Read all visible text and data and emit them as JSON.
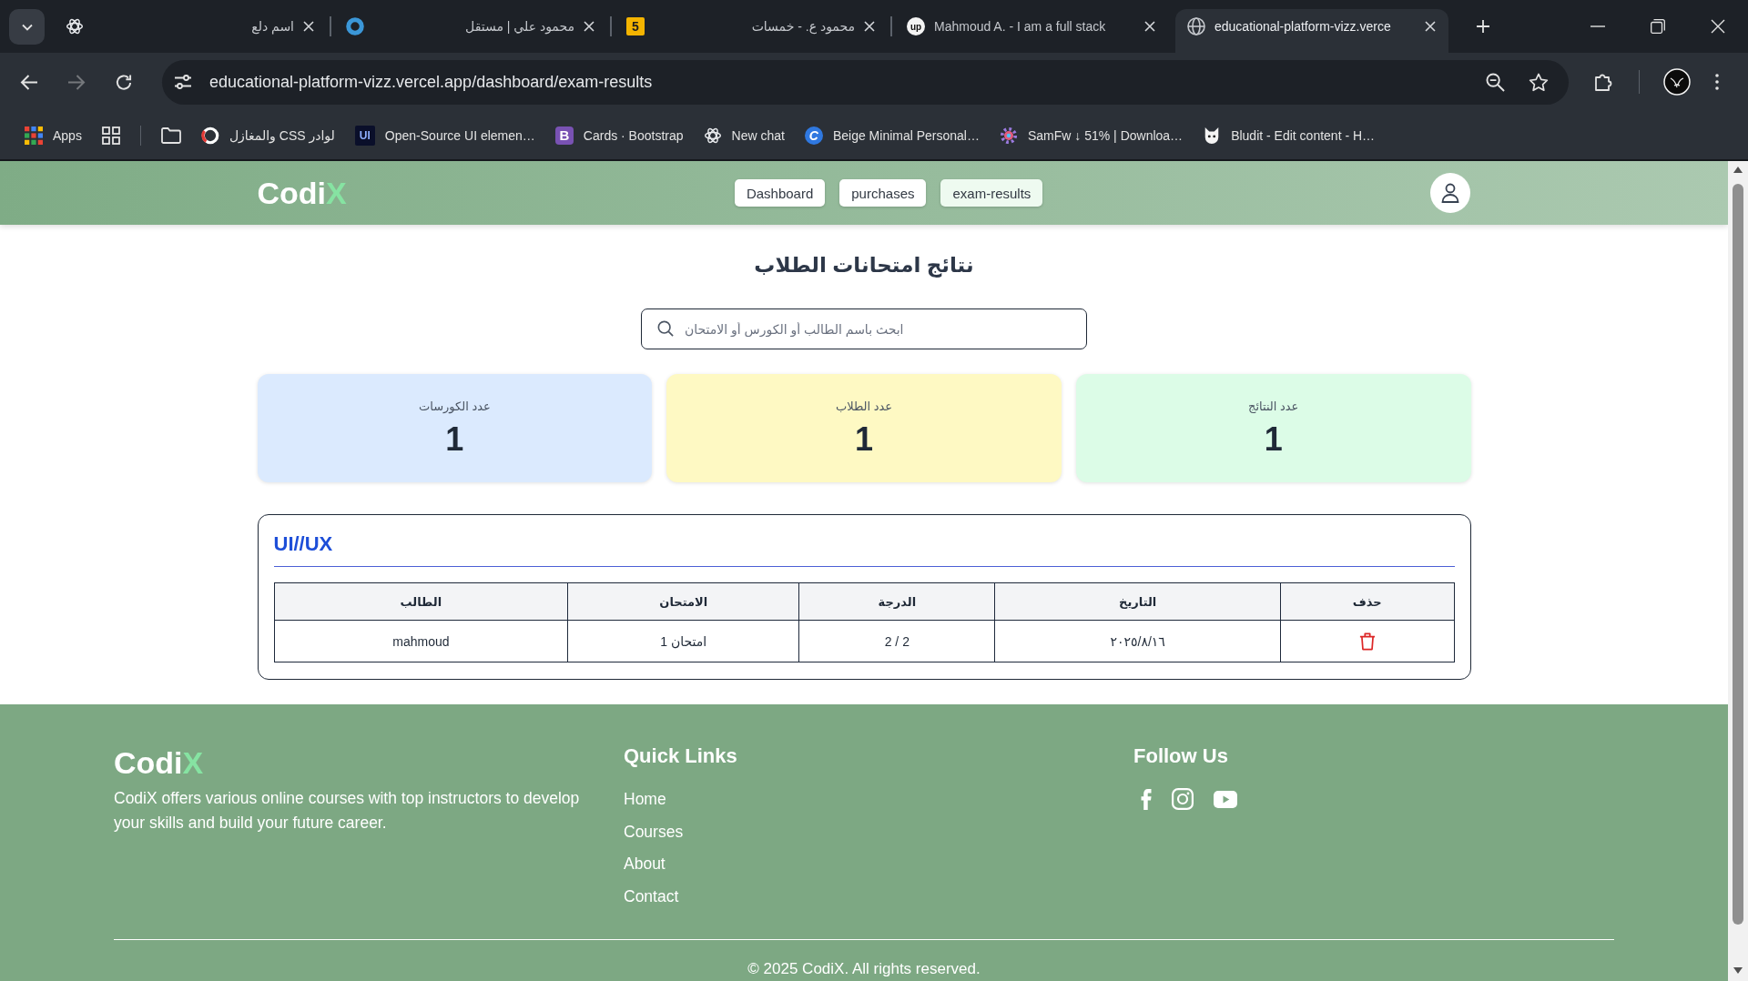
{
  "browser": {
    "tabs": [
      {
        "title": "educational-platform-vizz.verce",
        "kind": "globe",
        "selected": true
      },
      {
        "title": "Mahmoud A. - I am a full stack",
        "kind": "badge",
        "icon_text": "up",
        "selected": false
      },
      {
        "title": "محمود ع. - خمسات",
        "kind": "tile",
        "icon_text": "5",
        "selected": false
      },
      {
        "title": "محمود علي | مستقل",
        "kind": "ring",
        "selected": false
      },
      {
        "title": "اسم دلع",
        "kind": "atom",
        "selected": false
      }
    ],
    "forward_disabled": true,
    "url": "educational-platform-vizz.vercel.app/dashboard/exam-results",
    "bookmarks": [
      {
        "label": "Bludit - Edit content - H…",
        "kind": "cat"
      },
      {
        "label": "SamFw ↓ 51% | Downloa…",
        "kind": "flower"
      },
      {
        "label": "Beige Minimal Personal…",
        "kind": "circle",
        "icon_text": "C"
      },
      {
        "label": "New chat",
        "kind": "atom"
      },
      {
        "label": "Cards · Bootstrap",
        "kind": "purple-tile",
        "icon_text": "B"
      },
      {
        "label": "Open-Source UI elemen…",
        "kind": "dark-tile",
        "icon_text": "UI"
      },
      {
        "label": "لوادر CSS والمغازل",
        "kind": "loader"
      }
    ],
    "apps_label": "Apps"
  },
  "site": {
    "logo": {
      "text": "Codi",
      "accent": "X"
    },
    "nav": [
      {
        "label": "exam-results",
        "selected": true
      },
      {
        "label": "purchases",
        "selected": false
      },
      {
        "label": "Dashboard",
        "selected": false
      }
    ]
  },
  "page_title": "نتائج امتحانات الطلاب",
  "search": {
    "placeholder": "ابحث باسم الطالب أو الكورس أو الامتحان"
  },
  "stats": [
    {
      "label": "عدد النتائج",
      "value": "1",
      "color": "#dcfce7"
    },
    {
      "label": "عدد الطلاب",
      "value": "1",
      "color": "#fef9c3"
    },
    {
      "label": "عدد الكورسات",
      "value": "1",
      "color": "#dbeafe"
    }
  ],
  "courses": [
    {
      "title": "UI//UX",
      "columns": [
        "حذف",
        "التاريخ",
        "الدرجة",
        "الامتحان",
        "الطالب"
      ],
      "rows": [
        {
          "cells": [
            "",
            "٢٠٢٥/٨/١٦",
            "2 / 2",
            "امتحان 1",
            "mahmoud"
          ]
        }
      ]
    }
  ],
  "footer": {
    "logo": {
      "text": "Codi",
      "accent": "X"
    },
    "description": "CodiX offers various online courses with top instructors to develop your skills and build your future career.",
    "links_title": "Quick Links",
    "links": [
      "Home",
      "Courses",
      "About",
      "Contact"
    ],
    "social_title": "Follow Us",
    "copyright": "© 2025 CodiX. All rights reserved."
  }
}
